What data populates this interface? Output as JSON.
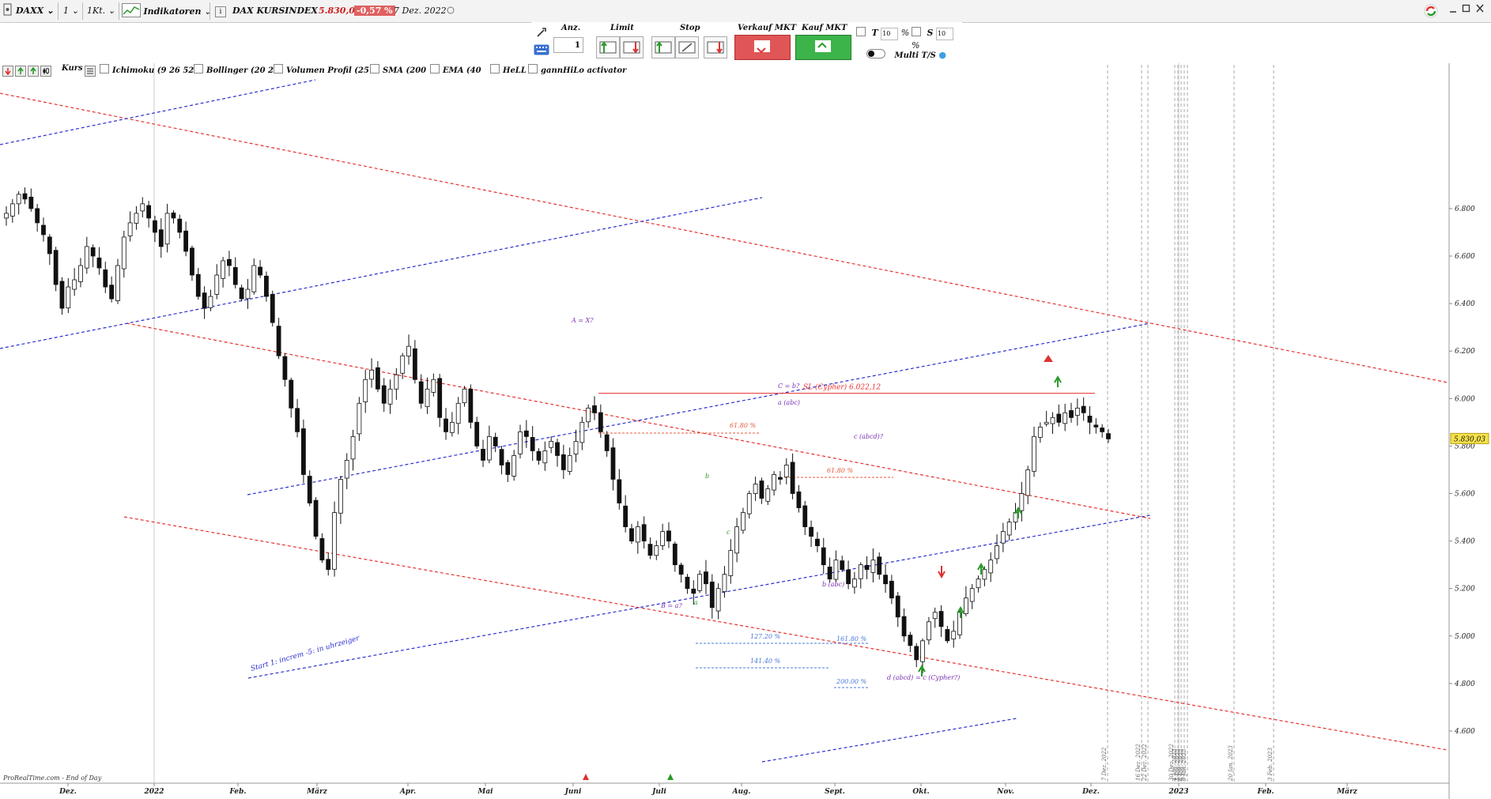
{
  "toolbar": {
    "instrument": "DAXX",
    "interval_count": "1",
    "interval_unit": "1Kt.",
    "indicators_label": "Indikatoren",
    "info": "i",
    "title": "DAX KURSINDEX",
    "price": "5.830,03",
    "change": "-0,57 %",
    "date": "7 Dez. 2022"
  },
  "order": {
    "anz_label": "Anz.",
    "anz_value": "1",
    "limit_label": "Limit",
    "stop_label": "Stop",
    "sell_label": "Verkauf MKT",
    "buy_label": "Kauf MKT",
    "t_label": "T",
    "t_value": "10",
    "t_unit": "%",
    "s_label": "S",
    "s_value": "10",
    "s_unit": "%",
    "multi_label": "Multi T/S"
  },
  "indicators": {
    "kurs": "Kurs",
    "ichimoku": "Ichimoku (9 26 52",
    "bollinger": "Bollinger (20 2",
    "volumen": "Volumen Profil (25",
    "sma": "SMA (200",
    "ema": "EMA (40",
    "hell": "HeLL",
    "gann": "gannHiLo activator"
  },
  "colors": {
    "red_channel": "#e8302e",
    "blue_channel": "#2a2fd0",
    "candle": "#111111",
    "price_tag": "#f5e24a",
    "fib_red": "#e85a3a",
    "fib_blue": "#4a78d8",
    "wave_purple": "#7a2fb0",
    "wave_green": "#2a9a2a"
  },
  "footer_source": "ProRealTime.com - End of Day",
  "chart_data": {
    "type": "candlestick",
    "y_axis": {
      "min": 4470,
      "max": 6920,
      "ticks": [
        4600,
        4800,
        5000,
        5200,
        5400,
        5600,
        5800,
        6000,
        6200,
        6400,
        6600,
        6800
      ],
      "tick_labels": [
        "4.600",
        "4.800",
        "5.000",
        "5.200",
        "5.400",
        "5.600",
        "5.800",
        "6.000",
        "6.200",
        "6.400",
        "6.600",
        "6.800"
      ]
    },
    "x_axis": {
      "labels": [
        "Dez.",
        "2022",
        "Feb.",
        "März",
        "Apr.",
        "Mai",
        "Juni",
        "Juli",
        "Aug.",
        "Sept.",
        "Okt.",
        "Nov.",
        "Dez.",
        "2023",
        "Feb.",
        "März"
      ]
    },
    "last_price_label": "5.830,03",
    "last_price": 5830.03,
    "path": [
      [
        6780,
        6820,
        6860,
        6840,
        6800,
        6740,
        6690,
        6610,
        6480,
        6380,
        6470,
        6500,
        6560,
        6640,
        6600,
        6550,
        6470,
        6420,
        6560,
        6680,
        6740,
        6780,
        6820,
        6760,
        6700,
        6640,
        6780,
        6760,
        6700,
        6620,
        6520,
        6430,
        6380,
        6430,
        6520,
        6580,
        6560,
        6480,
        6420,
        6460,
        6560,
        6520,
        6430,
        6320,
        6180,
        6080,
        5960,
        5860,
        5680,
        5560,
        5420,
        5320,
        5280,
        5520,
        5660,
        5740,
        5840,
        5980,
        6080,
        6120,
        6040,
        5980,
        6040,
        6100,
        6180,
        6220,
        6080,
        5980,
        6040,
        6080,
        5920,
        5860,
        5900,
        5980,
        6040,
        5900,
        5800,
        5740,
        5840,
        5800,
        5720,
        5680,
        5760,
        5860,
        5840,
        5780,
        5740,
        5780,
        5820,
        5760,
        5700,
        5760,
        5820,
        5900,
        5960,
        5940,
        5860,
        5780,
        5660,
        5560,
        5460,
        5400,
        5460,
        5400,
        5340,
        5380,
        5440,
        5400,
        5300,
        5260,
        5200,
        5180,
        5260,
        5220,
        5120,
        5200,
        5260,
        5360,
        5460,
        5520,
        5600,
        5640,
        5580,
        5620,
        5680,
        5660,
        5720,
        5600,
        5540,
        5460,
        5420,
        5380,
        5300,
        5240,
        5320,
        5280,
        5220,
        5240,
        5300,
        5280,
        5320,
        5260,
        5220,
        5160,
        5080,
        5000,
        4960,
        4900,
        4980,
        5060,
        5100,
        5040,
        4980,
        5020,
        5100,
        5160,
        5200,
        5240,
        5280,
        5320,
        5380,
        5440,
        5480,
        5520,
        5600,
        5700,
        5840,
        5880,
        5900,
        5920,
        5900,
        5940,
        5920,
        5960,
        5940,
        5900,
        5880,
        5860,
        5830
      ]
    ],
    "lines": [
      {
        "name": "SL (Cypher) 6.022,12",
        "value": 6022.12
      }
    ],
    "fib_levels": [
      "61.80 %",
      "61.80 %",
      "127.20 %",
      "141.40 %",
      "161.80 %",
      "200.00 %"
    ],
    "wave_labels": [
      "A = X?",
      "B = a?",
      "C = b?",
      "a (abc)",
      "b (abc)",
      "c (abcd)?",
      "d (abcd) = c (Cypher?)"
    ],
    "wave_small": [
      "a",
      "b",
      "c"
    ],
    "annotation": "Start 1: increm -5: in uhrzeiger",
    "vertical_markers": [
      "7 Dez. 2022",
      "16 Dez. 2022",
      "22 Dez. 2022",
      "30 Dez. 2022",
      "4 Jan. 2023",
      "5 Jan. 2023",
      "6 Jan. 2023",
      "9 Jan. 2023",
      "20 Jan. 2023",
      "3 Feb. 2023"
    ]
  }
}
